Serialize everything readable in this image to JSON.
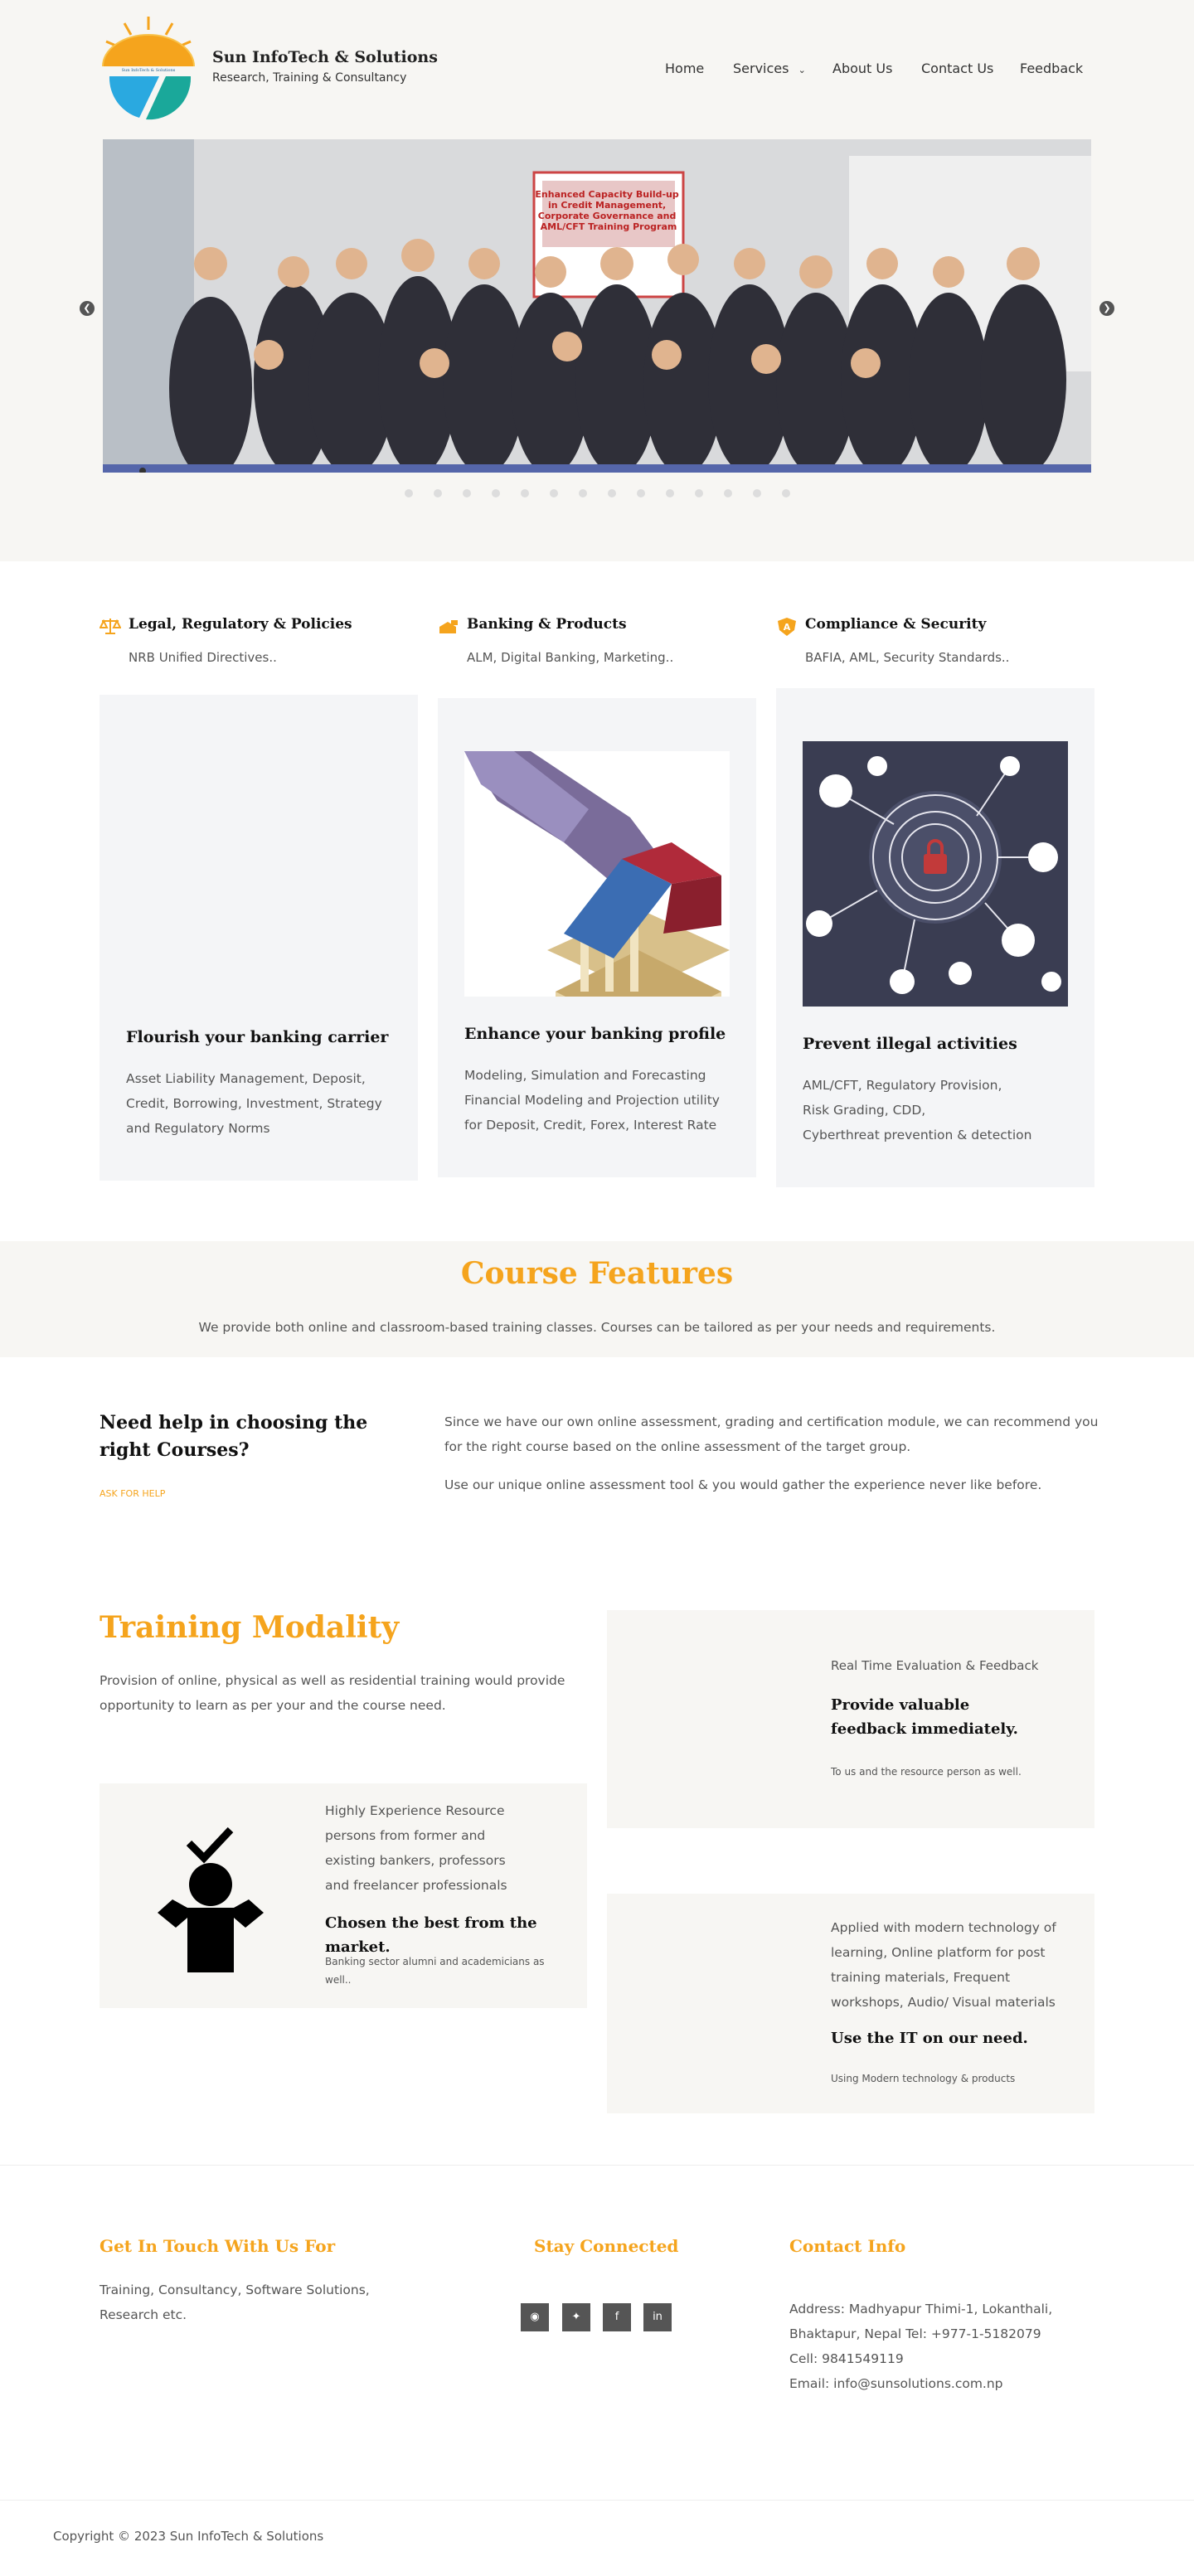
{
  "brand": {
    "name": "Sun InfoTech & Solutions",
    "tagline": "Research, Training & Consultancy",
    "logo_text": "Sun InfoTech & Solutions"
  },
  "nav": {
    "home": "Home",
    "services": "Services",
    "about": "About Us",
    "contact": "Contact Us",
    "feedback": "Feedback"
  },
  "slider": {
    "banner_text": "Enhanced Capacity Build-up in Credit Management, Corporate Governance and AML/CFT Training Program",
    "slide_count": 14,
    "active_slide": 1
  },
  "services": [
    {
      "title": "Legal, Regulatory & Policies",
      "subtitle": "NRB Unified Directives..",
      "icon": "scales-icon"
    },
    {
      "title": "Banking & Products",
      "subtitle": "ALM, Digital Banking, Marketing..",
      "icon": "bank-icon"
    },
    {
      "title": "Compliance & Security",
      "subtitle": "BAFIA, AML, Security Standards..",
      "icon": "shield-icon"
    }
  ],
  "cards": [
    {
      "heading": "Flourish your banking carrier",
      "lines": [
        "Asset Liability Management, Deposit,",
        "Credit, Borrowing, Investment, Strategy",
        "and Regulatory Norms"
      ]
    },
    {
      "heading": "Enhance your banking profile",
      "lines": [
        "Modeling, Simulation and Forecasting",
        "Financial Modeling and Projection utility",
        "for Deposit, Credit, Forex, Interest Rate"
      ]
    },
    {
      "heading": "Prevent illegal activities",
      "lines": [
        "AML/CFT, Regulatory Provision,",
        "Risk Grading, CDD,",
        "Cyberthreat prevention & detection"
      ]
    }
  ],
  "features": {
    "title": "Course Features",
    "subtitle": "We provide both online and classroom-based training classes. Courses can be tailored as per your needs and requirements."
  },
  "help": {
    "heading": "Need help in choosing the right Courses?",
    "link": "ASK FOR HELP",
    "para1": "Since we have our own online assessment, grading and certification module, we can recommend you for the right course based on the online assessment of the target group.",
    "para2": "Use our unique online assessment tool & you would gather the experience never like before."
  },
  "modality": {
    "title": "Training Modality",
    "intro": "Provision of online, physical as well as residential training would provide opportunity to learn as per your and the course need.",
    "boxes": [
      {
        "label": "Real Time Evaluation & Feedback",
        "heading": "Provide valuable feedback immediately.",
        "note": "To us and the resource person as well."
      },
      {
        "label": "Highly Experience Resource persons from  former and existing bankers, professors and freelancer professionals",
        "heading": "Chosen the best from the market.",
        "note": "Banking sector alumni and academicians as well..",
        "icon": "person-check-icon"
      },
      {
        "label": "Applied with modern technology of learning, Online platform for post training materials, Frequent workshops, Audio/ Visual materials",
        "heading": "Use the IT on our need.",
        "note": "Using Modern technology & products"
      }
    ]
  },
  "footer": {
    "col1": {
      "title": "Get In Touch With Us For",
      "text": "Training, Consultancy, Software Solutions, Research etc."
    },
    "col2": {
      "title": "Stay Connected",
      "icons": [
        "instagram-icon",
        "twitter-icon",
        "facebook-icon",
        "linkedin-icon"
      ]
    },
    "col3": {
      "title": "Contact Info",
      "address": "Address: Madhyapur Thimi-1, Lokanthali, Bhaktapur, Nepal Tel: +977-1-5182079 Cell: 9841549119",
      "email": "Email: info@sunsolutions.com.np"
    },
    "copyright": "Copyright © 2023 Sun InfoTech & Solutions"
  },
  "colors": {
    "accent": "#f5a41d",
    "band": "#f7f6f3",
    "card": "#f4f5f7"
  }
}
